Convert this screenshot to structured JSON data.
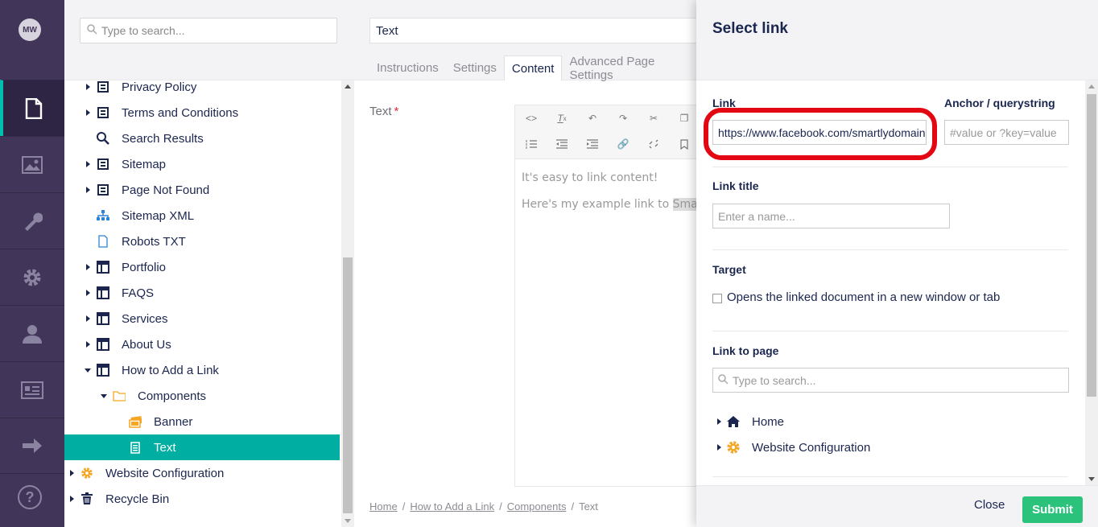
{
  "user": {
    "initials": "MW"
  },
  "nav": {
    "sections": [
      {
        "icon": "content-icon",
        "active": true
      },
      {
        "icon": "media-icon",
        "active": false
      },
      {
        "icon": "wrench-icon",
        "active": false
      },
      {
        "icon": "settings-gear-icon",
        "active": false
      },
      {
        "icon": "user-icon",
        "active": false
      },
      {
        "icon": "contact-card-icon",
        "active": false
      },
      {
        "icon": "arrow-right-icon",
        "active": false
      }
    ],
    "help": "?"
  },
  "tree": {
    "search_placeholder": "Type to search...",
    "nodes": [
      {
        "label": "Privacy Policy",
        "icon": "page-icon",
        "caret": "right",
        "indent": 0
      },
      {
        "label": "Terms and Conditions",
        "icon": "page-icon",
        "caret": "right",
        "indent": 0
      },
      {
        "label": "Search Results",
        "icon": "search-icon",
        "caret": "none",
        "indent": 0
      },
      {
        "label": "Sitemap",
        "icon": "page-icon",
        "caret": "right",
        "indent": 0
      },
      {
        "label": "Page Not Found",
        "icon": "page-icon",
        "caret": "right",
        "indent": 0
      },
      {
        "label": "Sitemap XML",
        "icon": "sitemap-icon",
        "caret": "none",
        "indent": 0
      },
      {
        "label": "Robots TXT",
        "icon": "document-icon",
        "caret": "none",
        "indent": 0
      },
      {
        "label": "Portfolio",
        "icon": "layout-icon",
        "caret": "right",
        "indent": 0
      },
      {
        "label": "FAQS",
        "icon": "layout-icon",
        "caret": "right",
        "indent": 0
      },
      {
        "label": "Services",
        "icon": "layout-icon",
        "caret": "right",
        "indent": 0
      },
      {
        "label": "About Us",
        "icon": "layout-icon",
        "caret": "right",
        "indent": 0
      },
      {
        "label": "How to Add a Link",
        "icon": "layout-icon",
        "caret": "down",
        "indent": 0
      },
      {
        "label": "Components",
        "icon": "folder-icon",
        "caret": "down",
        "indent": 1
      },
      {
        "label": "Banner",
        "icon": "banner-icon",
        "caret": "none",
        "indent": 2
      },
      {
        "label": "Text",
        "icon": "text-doc-icon",
        "caret": "none",
        "indent": 2,
        "selected": true
      },
      {
        "label": "Website Configuration",
        "icon": "gear-orange-icon",
        "caret": "right",
        "indent": -1
      },
      {
        "label": "Recycle Bin",
        "icon": "trash-icon",
        "caret": "right",
        "indent": -1
      }
    ]
  },
  "editor": {
    "name_value": "Text",
    "tabs": [
      "Instructions",
      "Settings",
      "Content",
      "Advanced Page Settings"
    ],
    "active_tab": "Content",
    "field_label": "Text",
    "required_mark": "*",
    "rte_line1": "It's easy to link content!",
    "rte_line2_prefix": "Here's my example link to ",
    "rte_line2_highlight": "Sma",
    "breadcrumb": [
      "Home",
      "How to Add a Link",
      "Components",
      "Text"
    ],
    "breadcrumb_sep": "/"
  },
  "dialog": {
    "title": "Select link",
    "link_label": "Link",
    "link_value": "https://www.facebook.com/smartlydomains",
    "anchor_label": "Anchor / querystring",
    "anchor_placeholder": "#value or ?key=value",
    "link_title_label": "Link title",
    "link_title_placeholder": "Enter a name...",
    "target_label": "Target",
    "target_checkbox_label": "Opens the linked document in a new window or tab",
    "link_to_page_label": "Link to page",
    "page_search_placeholder": "Type to search...",
    "page_nodes": [
      {
        "label": "Home",
        "icon": "home-icon"
      },
      {
        "label": "Website Configuration",
        "icon": "gear-orange-icon"
      }
    ],
    "close_label": "Close",
    "submit_label": "Submit"
  },
  "colors": {
    "nav_bg": "#413659",
    "accent_teal": "#00aea2",
    "submit_green": "#2bc37c",
    "highlight_red": "#e30613",
    "text_dark": "#1b264f"
  }
}
